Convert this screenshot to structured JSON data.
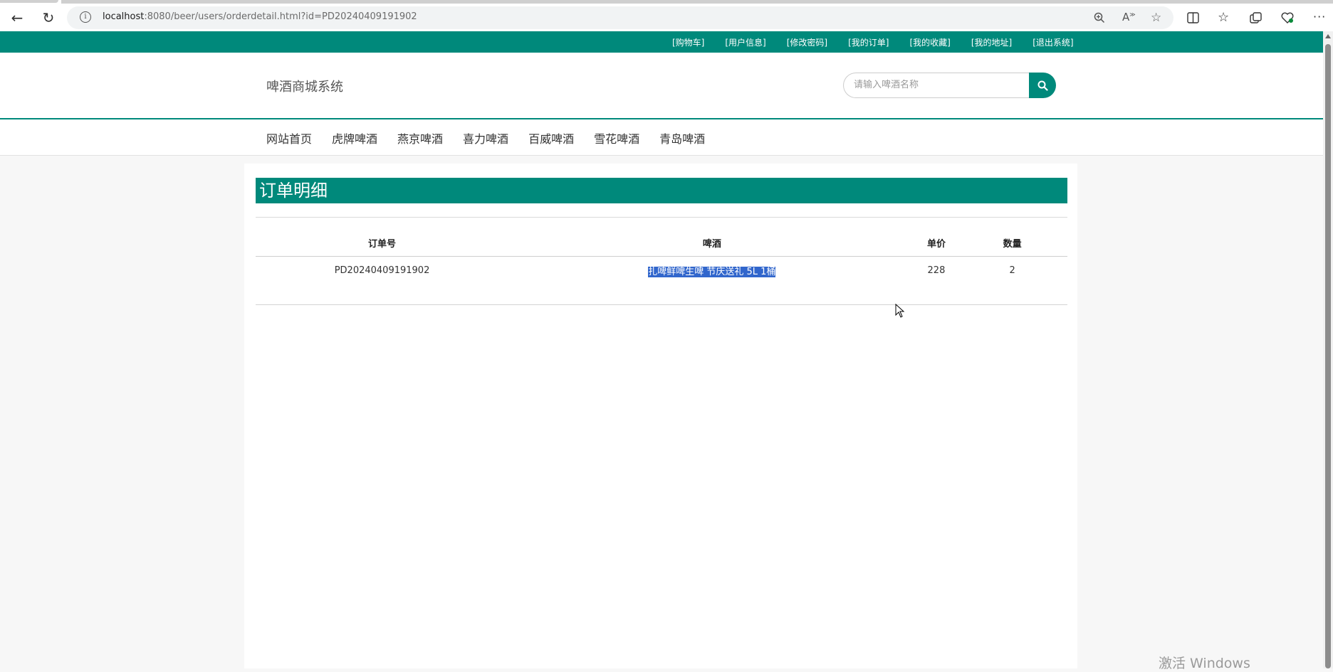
{
  "browser": {
    "url_host": "localhost",
    "url_rest": ":8080/beer/users/orderdetail.html?id=PD20240409191902",
    "read_aloud_label": "A"
  },
  "topbar": {
    "links": [
      "[购物车]",
      "[用户信息]",
      "[修改密码]",
      "[我的订单]",
      "[我的收藏]",
      "[我的地址]",
      "[退出系统]"
    ]
  },
  "header": {
    "logo": "啤酒商城系统",
    "search_placeholder": "请输入啤酒名称"
  },
  "nav": {
    "items": [
      "网站首页",
      "虎牌啤酒",
      "燕京啤酒",
      "喜力啤酒",
      "百威啤酒",
      "雪花啤酒",
      "青岛啤酒"
    ]
  },
  "main": {
    "title": "订单明细",
    "columns": [
      "订单号",
      "啤酒",
      "单价",
      "数量"
    ],
    "rows": [
      {
        "order_no": "PD20240409191902",
        "beer": "扎啤鲜啤生啤 节庆送礼 5L 1桶",
        "price": "228",
        "qty": "2"
      }
    ]
  },
  "watermark": "激活 Windows",
  "colors": {
    "brand": "#00897b",
    "selection": "#3166cc"
  }
}
